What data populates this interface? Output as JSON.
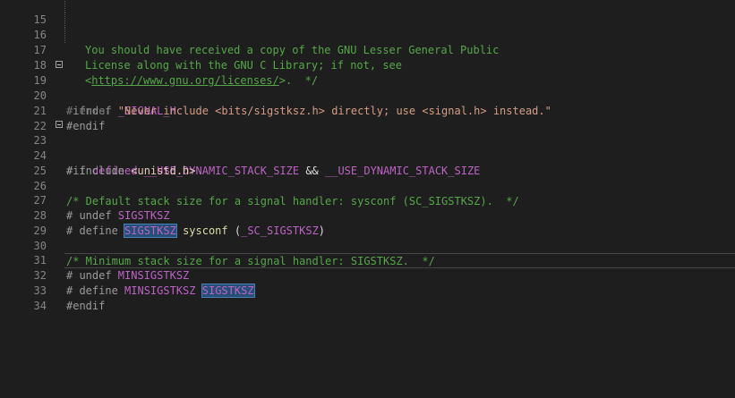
{
  "lines": [
    {
      "n": "15",
      "t1": "You should have received a copy of the GNU Lesser General Public"
    },
    {
      "n": "16",
      "t1": "License along with the GNU C Library; if not, see"
    },
    {
      "n": "17",
      "t1": "<",
      "link": "https://www.gnu.org/licenses/",
      "t2": ">.  */"
    },
    {
      "n": "18"
    },
    {
      "n": "19",
      "kw": "#ifndef ",
      "macro": "_SIGNAL_H"
    },
    {
      "n": "20",
      "kw": "# error ",
      "str": "\"Never include <bits/sigstksz.h> directly; use <signal.h> instead.\""
    },
    {
      "n": "21",
      "kw": "#endif"
    },
    {
      "n": "22"
    },
    {
      "n": "23",
      "kw": "#if ",
      "kw2": "defined ",
      "m1": "__USE_DYNAMIC_STACK_SIZE",
      "op": " && ",
      "m2": "__USE_DYNAMIC_STACK_SIZE"
    },
    {
      "n": "24",
      "kw": "# include ",
      "inc": "<unistd.h>"
    },
    {
      "n": "25"
    },
    {
      "n": "26",
      "cmt": "/* Default stack size for a signal handler: sysconf (SC_SIGSTKSZ).  */"
    },
    {
      "n": "27",
      "kw": "# undef ",
      "macro": "SIGSTKSZ"
    },
    {
      "n": "28",
      "kw": "# define ",
      "hl": "SIGSTKSZ",
      "sp": " ",
      "fn": "sysconf",
      "p1": " (",
      "m": "_SC_SIGSTKSZ",
      "p2": ")"
    },
    {
      "n": "29"
    },
    {
      "n": "30",
      "cmt": "/* Minimum stack size for a signal handler: SIGSTKSZ.  */"
    },
    {
      "n": "31",
      "kw": "# undef ",
      "macro": "MINSIGSTKSZ"
    },
    {
      "n": "32",
      "kw": "# define ",
      "macro": "MINSIGSTKSZ",
      "sp": " ",
      "hl": "SIGSTKSZ"
    },
    {
      "n": "33",
      "kw": "#endif"
    },
    {
      "n": "34"
    }
  ],
  "colors": {
    "background": "#1e1e1e",
    "comment": "#57a64a",
    "macro": "#bd63c5",
    "string": "#d69d85",
    "preprocessor": "#9b9b9b",
    "highlight": "#264f78"
  }
}
